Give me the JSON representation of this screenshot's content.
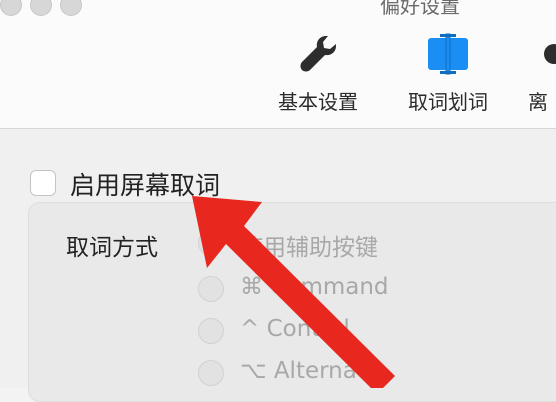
{
  "window": {
    "title": "偏好设置"
  },
  "toolbar": {
    "items": [
      {
        "label": "基本设置",
        "icon": "wrench-icon"
      },
      {
        "label": "取词划词",
        "icon": "text-selection-icon",
        "active_color": "#1a8ef2"
      },
      {
        "label": "离",
        "icon": "partial-icon"
      }
    ]
  },
  "panel": {
    "enable_label": "启用屏幕取词",
    "enable_checked": false,
    "method_label": "取词方式",
    "options": [
      {
        "label": "使用辅助按键"
      },
      {
        "label": "⌘ Command"
      },
      {
        "label": "^ Control"
      },
      {
        "label": "⌥ Alternate"
      }
    ]
  },
  "annotation": {
    "arrow_color": "#e8281f"
  }
}
